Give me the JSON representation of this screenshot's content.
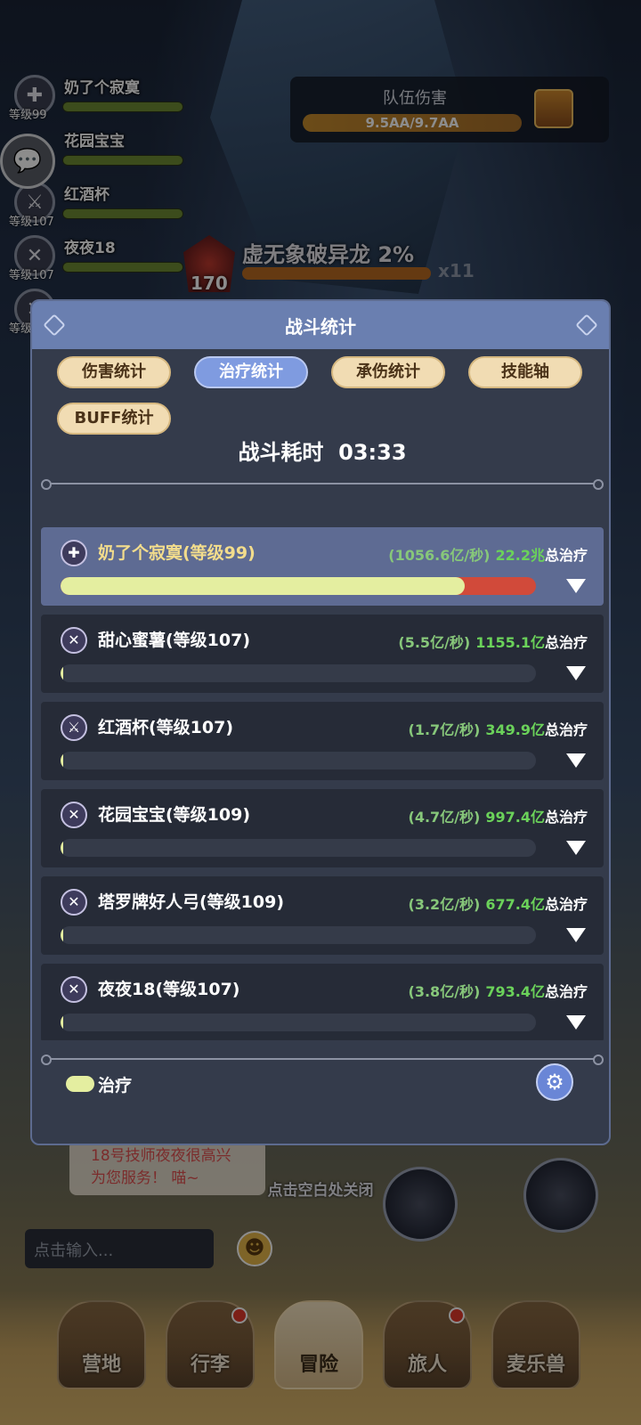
{
  "party": [
    {
      "name": "奶了个寂寞",
      "level": "等级99",
      "icon": "healer-cross-icon"
    },
    {
      "name": "花园宝宝",
      "level": "",
      "icon": "chat-covered"
    },
    {
      "name": "红酒杯",
      "level": "等级107",
      "icon": "sword-icon"
    },
    {
      "name": "夜夜18",
      "level": "等级107",
      "icon": "crossed-swords-icon"
    },
    {
      "name": "",
      "level": "等级",
      "icon": "crossed-swords-icon"
    }
  ],
  "team_damage": {
    "title": "队伍伤害",
    "value": "9.5AA/9.7AA"
  },
  "boss": {
    "name": "虚无象破异龙",
    "percent": "2%",
    "level": "170",
    "multiplier": "x11"
  },
  "modal": {
    "title": "战斗统计",
    "tabs": [
      "伤害统计",
      "治疗统计",
      "承伤统计",
      "技能轴",
      "BUFF统计"
    ],
    "active_tab": "治疗统计",
    "battle_time_label": "战斗耗时",
    "battle_time": "03:33",
    "rows": [
      {
        "name": "奶了个寂寞(等级99)",
        "rate": "(1056.6亿/秒)",
        "total": "22.2兆",
        "total_label": "总治疗",
        "fill": 0.85,
        "self": true
      },
      {
        "name": "甜心蜜薯(等级107)",
        "rate": "(5.5亿/秒)",
        "total": "1155.1亿",
        "total_label": "总治疗",
        "fill": 0.005,
        "self": false
      },
      {
        "name": "红酒杯(等级107)",
        "rate": "(1.7亿/秒)",
        "total": "349.9亿",
        "total_label": "总治疗",
        "fill": 0.002,
        "self": false
      },
      {
        "name": "花园宝宝(等级109)",
        "rate": "(4.7亿/秒)",
        "total": "997.4亿",
        "total_label": "总治疗",
        "fill": 0.005,
        "self": false
      },
      {
        "name": "塔罗牌好人弓(等级109)",
        "rate": "(3.2亿/秒)",
        "total": "677.4亿",
        "total_label": "总治疗",
        "fill": 0.003,
        "self": false
      },
      {
        "name": "夜夜18(等级107)",
        "rate": "(3.8亿/秒)",
        "total": "793.4亿",
        "total_label": "总治疗",
        "fill": 0.004,
        "self": false
      }
    ],
    "legend_label": "治疗",
    "legend_color": "#e4eea0"
  },
  "close_hint": "点击空白处关闭",
  "chat_message": "18号技师夜夜很高兴为您服务！ 喵~",
  "chat_input_placeholder": "点击输入...",
  "nav": [
    {
      "label": "营地",
      "badge": false
    },
    {
      "label": "行李",
      "badge": true
    },
    {
      "label": "冒险",
      "badge": false,
      "active": true
    },
    {
      "label": "旅人",
      "badge": true
    },
    {
      "label": "麦乐兽",
      "badge": false
    }
  ]
}
